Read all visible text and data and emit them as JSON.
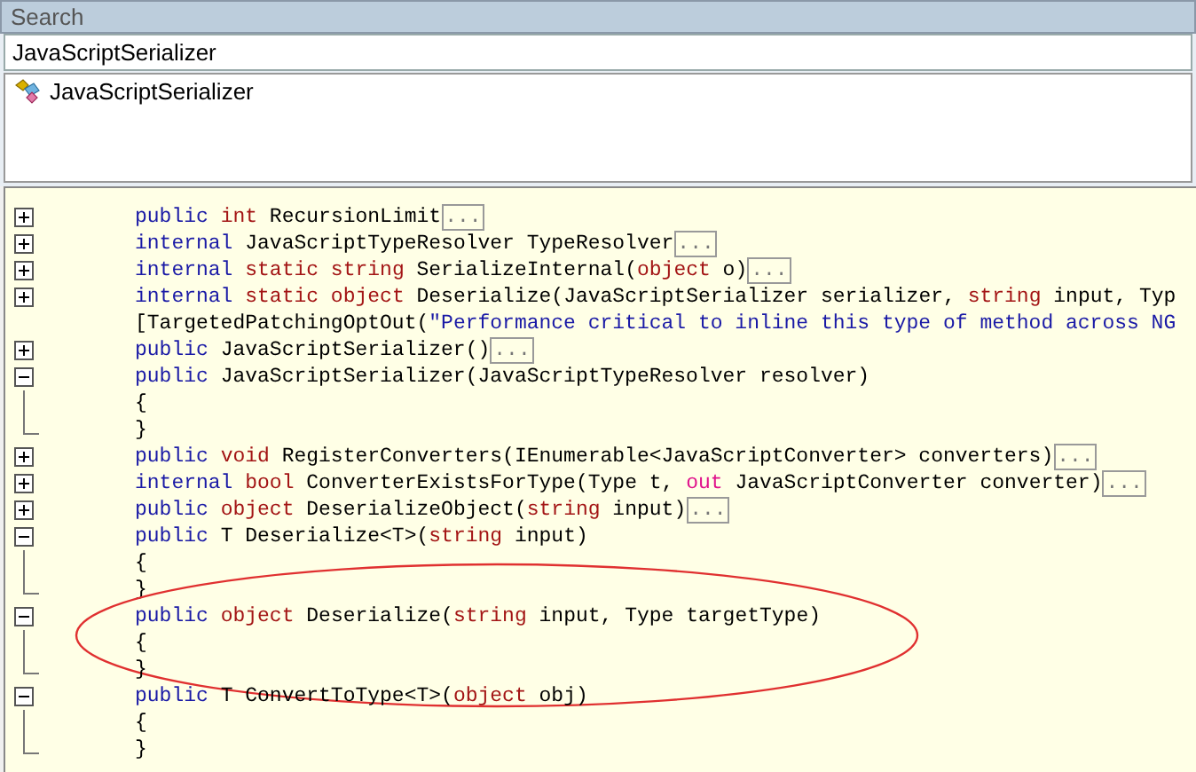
{
  "search": {
    "title": "Search",
    "value": "JavaScriptSerializer",
    "results": [
      {
        "label": "JavaScriptSerializer"
      }
    ]
  },
  "code": {
    "lines": [
      {
        "kind": "member",
        "expanded": false,
        "collapsed": true,
        "tokens": [
          {
            "kind": "kw",
            "text": "public "
          },
          {
            "kind": "type",
            "text": "int"
          },
          {
            "kind": "plain",
            "text": " RecursionLimit"
          }
        ]
      },
      {
        "kind": "member",
        "expanded": false,
        "collapsed": true,
        "tokens": [
          {
            "kind": "kw",
            "text": "internal "
          },
          {
            "kind": "plain",
            "text": "JavaScriptTypeResolver TypeResolver"
          }
        ]
      },
      {
        "kind": "member",
        "expanded": false,
        "collapsed": true,
        "tokens": [
          {
            "kind": "kw",
            "text": "internal "
          },
          {
            "kind": "type",
            "text": "static string "
          },
          {
            "kind": "plain",
            "text": "SerializeInternal("
          },
          {
            "kind": "type",
            "text": "object"
          },
          {
            "kind": "plain",
            "text": " o)"
          }
        ]
      },
      {
        "kind": "member",
        "expanded": false,
        "collapsed": false,
        "tokens": [
          {
            "kind": "kw",
            "text": "internal "
          },
          {
            "kind": "type",
            "text": "static object "
          },
          {
            "kind": "plain",
            "text": "Deserialize(JavaScriptSerializer serializer, "
          },
          {
            "kind": "type",
            "text": "string"
          },
          {
            "kind": "plain",
            "text": " input, Typ"
          }
        ]
      },
      {
        "kind": "attribute",
        "collapsed": false,
        "tokens": [
          {
            "kind": "plain",
            "text": "[TargetedPatchingOptOut("
          },
          {
            "kind": "str",
            "text": "\"Performance critical to inline this type of method across NG"
          }
        ]
      },
      {
        "kind": "member",
        "expanded": false,
        "collapsed": true,
        "tokens": [
          {
            "kind": "kw",
            "text": "public "
          },
          {
            "kind": "plain",
            "text": "JavaScriptSerializer()"
          }
        ]
      },
      {
        "kind": "member",
        "expanded": true,
        "collapsed": false,
        "tokens": [
          {
            "kind": "kw",
            "text": "public "
          },
          {
            "kind": "plain",
            "text": "JavaScriptSerializer(JavaScriptTypeResolver resolver)"
          }
        ]
      },
      {
        "kind": "body",
        "collapsed": false,
        "tokens": [
          {
            "kind": "plain",
            "text": "{"
          }
        ]
      },
      {
        "kind": "end",
        "collapsed": false,
        "tokens": [
          {
            "kind": "plain",
            "text": "}"
          }
        ]
      },
      {
        "kind": "member",
        "expanded": false,
        "collapsed": true,
        "tokens": [
          {
            "kind": "kw",
            "text": "public "
          },
          {
            "kind": "type",
            "text": "void"
          },
          {
            "kind": "plain",
            "text": " RegisterConverters(IEnumerable<JavaScriptConverter> converters)"
          }
        ]
      },
      {
        "kind": "member",
        "expanded": false,
        "collapsed": true,
        "tokens": [
          {
            "kind": "kw",
            "text": "internal "
          },
          {
            "kind": "type",
            "text": "bool"
          },
          {
            "kind": "plain",
            "text": " ConverterExistsForType(Type t, "
          },
          {
            "kind": "out",
            "text": "out"
          },
          {
            "kind": "plain",
            "text": " JavaScriptConverter converter)"
          }
        ]
      },
      {
        "kind": "member",
        "expanded": false,
        "collapsed": true,
        "tokens": [
          {
            "kind": "kw",
            "text": "public "
          },
          {
            "kind": "type",
            "text": "object"
          },
          {
            "kind": "plain",
            "text": " DeserializeObject("
          },
          {
            "kind": "type",
            "text": "string"
          },
          {
            "kind": "plain",
            "text": " input)"
          }
        ]
      },
      {
        "kind": "member",
        "expanded": true,
        "collapsed": false,
        "tokens": [
          {
            "kind": "kw",
            "text": "public "
          },
          {
            "kind": "plain",
            "text": "T Deserialize<T>("
          },
          {
            "kind": "type",
            "text": "string"
          },
          {
            "kind": "plain",
            "text": " input)"
          }
        ]
      },
      {
        "kind": "body",
        "collapsed": false,
        "tokens": [
          {
            "kind": "plain",
            "text": "{"
          }
        ]
      },
      {
        "kind": "end",
        "collapsed": false,
        "tokens": [
          {
            "kind": "plain",
            "text": "}"
          }
        ]
      },
      {
        "kind": "member",
        "expanded": true,
        "collapsed": false,
        "circled": true,
        "tokens": [
          {
            "kind": "kw",
            "text": "public "
          },
          {
            "kind": "type",
            "text": "object"
          },
          {
            "kind": "plain",
            "text": " Deserialize("
          },
          {
            "kind": "type",
            "text": "string"
          },
          {
            "kind": "plain",
            "text": " input, Type targetType)"
          }
        ]
      },
      {
        "kind": "body",
        "collapsed": false,
        "tokens": [
          {
            "kind": "plain",
            "text": "{"
          }
        ]
      },
      {
        "kind": "end",
        "collapsed": false,
        "tokens": [
          {
            "kind": "plain",
            "text": "}"
          }
        ]
      },
      {
        "kind": "member",
        "expanded": true,
        "collapsed": false,
        "tokens": [
          {
            "kind": "kw",
            "text": "public "
          },
          {
            "kind": "plain",
            "text": "T ConvertToType<T>("
          },
          {
            "kind": "type",
            "text": "object"
          },
          {
            "kind": "plain",
            "text": " obj)"
          }
        ]
      },
      {
        "kind": "body",
        "collapsed": false,
        "tokens": [
          {
            "kind": "plain",
            "text": "{"
          }
        ]
      },
      {
        "kind": "end",
        "collapsed": false,
        "tokens": [
          {
            "kind": "plain",
            "text": "}"
          }
        ]
      }
    ],
    "ellipsis": "..."
  }
}
